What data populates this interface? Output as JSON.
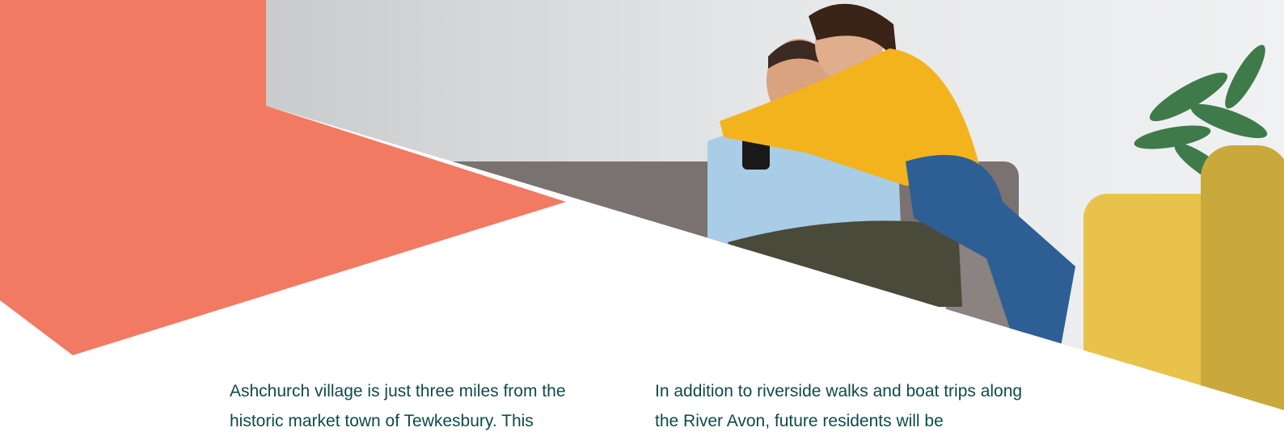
{
  "colors": {
    "accent_coral": "#f27a62",
    "text_teal": "#0f4a4a",
    "background": "#ffffff"
  },
  "hero": {
    "image": "couple-on-sofa-with-phone"
  },
  "content": {
    "left_paragraph": "Ashchurch village is just three miles from the historic market town of Tewkesbury. This",
    "right_paragraph": "In addition to riverside walks and boat trips along the River Avon, future residents will be"
  }
}
